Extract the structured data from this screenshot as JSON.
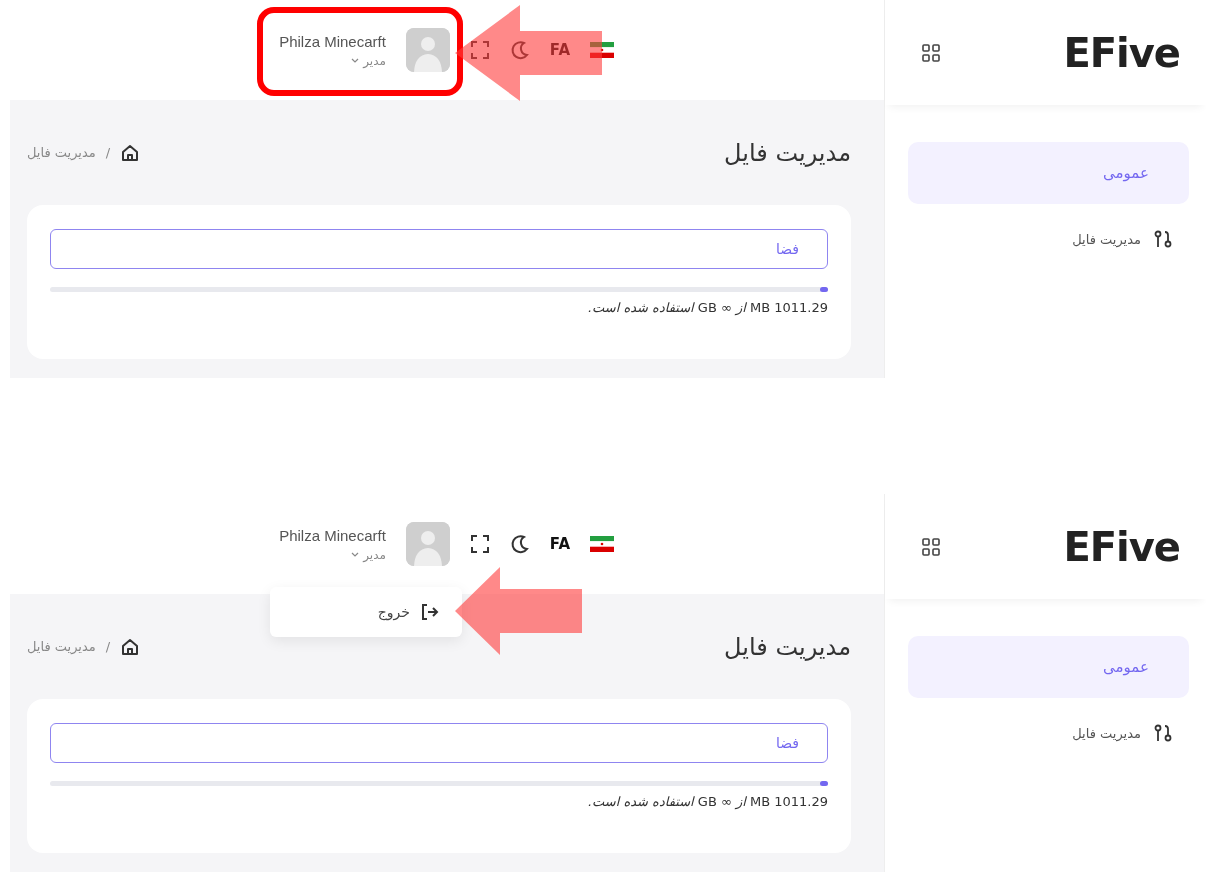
{
  "panels": [
    {
      "header": {
        "language": "FA",
        "user_name": "Philza Minecarft",
        "user_role": "مدیر"
      },
      "sidebar": {
        "logo": "EFive",
        "items": [
          {
            "label": "عمومی",
            "kind": "section",
            "selected": true
          },
          {
            "label": "مدیریت فایل",
            "kind": "link",
            "selected": false
          }
        ]
      },
      "page": {
        "title": "مدیریت فایل",
        "separator": "/",
        "breadcrumb": [
          "مدیریت فایل"
        ],
        "storage": {
          "placeholder": "فضا",
          "level": 0.01,
          "usage": "1011.29 MB *از ∞* GB *استفاده شده است.*"
        }
      },
      "annotations": [
        {
          "kind": "box"
        },
        {
          "kind": "user-arrow"
        }
      ]
    },
    {
      "header": {
        "language": "FA",
        "user_name": "Philza Minecarft",
        "user_role": "مدیر"
      },
      "user_menu": [
        {
          "label": "خروج"
        }
      ],
      "sidebar": {
        "logo": "EFive",
        "items": [
          {
            "label": "عمومی",
            "kind": "section",
            "selected": true
          },
          {
            "label": "مدیریت فایل",
            "kind": "link",
            "selected": false
          }
        ]
      },
      "page": {
        "title": "مدیریت فایل",
        "separator": "/",
        "breadcrumb": [
          "مدیریت فایل"
        ],
        "storage": {
          "placeholder": "فضا",
          "level": 0.01,
          "usage": "1011.29 MB *از ∞* GB *استفاده شده است.*"
        }
      },
      "annotations": [
        {
          "kind": "menu-arrow"
        }
      ]
    }
  ]
}
